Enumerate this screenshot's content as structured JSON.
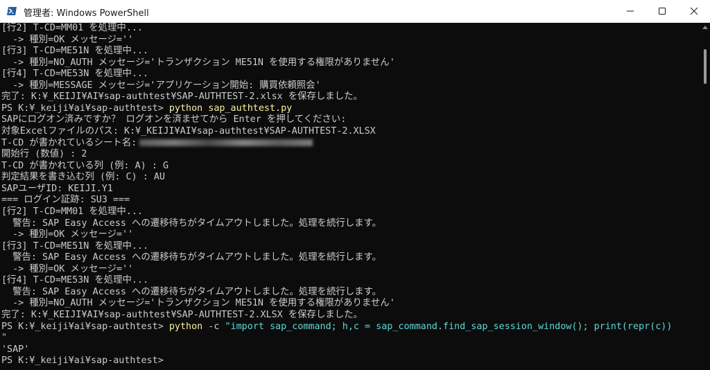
{
  "window": {
    "title": "管理者: Windows PowerShell",
    "icon": "powershell-icon"
  },
  "terminal": {
    "lines": [
      {
        "prefix": "[行2] T-CD=MM01 を処理中..."
      },
      {
        "prefix": "  -> 種別=OK メッセージ=''"
      },
      {
        "prefix": "[行3] T-CD=ME51N を処理中..."
      },
      {
        "prefix": "  -> 種別=NO_AUTH メッセージ='トランザクション ME51N を使用する権限がありません'"
      },
      {
        "prefix": "[行4] T-CD=ME53N を処理中..."
      },
      {
        "prefix": "  -> 種別=MESSAGE メッセージ='アプリケーション開始: 購買依頼照会'"
      },
      {
        "prefix": "完了: K:¥_KEIJI¥AI¥sap-authtest¥SAP-AUTHTEST-2.xlsx を保存しました。"
      },
      {
        "prefix": "PS K:¥_keiji¥ai¥sap-authtest> ",
        "cmd": "python sap_authtest.py"
      },
      {
        "prefix": "SAPにログオン済みですか？ ログオンを済ませてから Enter を押してください:"
      },
      {
        "prefix": "対象Excelファイルのパス: K:¥_KEIJI¥AI¥sap-authtest¥SAP-AUTHTEST-2.XLSX"
      },
      {
        "prefix": "T-CD が書かれているシート名:",
        "redacted": true
      },
      {
        "prefix": "開始行 (数値) : 2"
      },
      {
        "prefix": "T-CD が書かれている列 (例: A) : G"
      },
      {
        "prefix": "判定結果を書き込む列 (例: C) : AU"
      },
      {
        "prefix": "SAPユーザID: KEIJI.Y1"
      },
      {
        "prefix": "=== ログイン証跡: SU3 ==="
      },
      {
        "prefix": "[行2] T-CD=MM01 を処理中..."
      },
      {
        "prefix": "  警告: SAP Easy Access への遷移待ちがタイムアウトしました。処理を続行します。"
      },
      {
        "prefix": "  -> 種別=OK メッセージ=''"
      },
      {
        "prefix": "[行3] T-CD=ME51N を処理中..."
      },
      {
        "prefix": "  警告: SAP Easy Access への遷移待ちがタイムアウトしました。処理を続行します。"
      },
      {
        "prefix": "  -> 種別=OK メッセージ=''"
      },
      {
        "prefix": "[行4] T-CD=ME53N を処理中..."
      },
      {
        "prefix": "  警告: SAP Easy Access への遷移待ちがタイムアウトしました。処理を続行します。"
      },
      {
        "prefix": "  -> 種別=NO_AUTH メッセージ='トランザクション ME51N を使用する権限がありません'"
      },
      {
        "prefix": "完了: K:¥_KEIJI¥AI¥sap-authtest¥SAP-AUTHTEST-2.XLSX を保存しました。"
      },
      {
        "prefix": "PS K:¥_keiji¥ai¥sap-authtest> ",
        "cmd": "python",
        "arg": " -c ",
        "str": "\"import sap_command; h,c = sap_command.find_sap_session_window(); print(repr(c))"
      },
      {
        "prefix": "",
        "str": "\""
      },
      {
        "prefix": "'SAP'"
      },
      {
        "prefix": "PS K:¥_keiji¥ai¥sap-authtest>"
      }
    ]
  },
  "colors": {
    "background": "#0c0c0c",
    "text": "#cccccc",
    "command": "#f9f1a5",
    "string": "#61d6d6"
  }
}
